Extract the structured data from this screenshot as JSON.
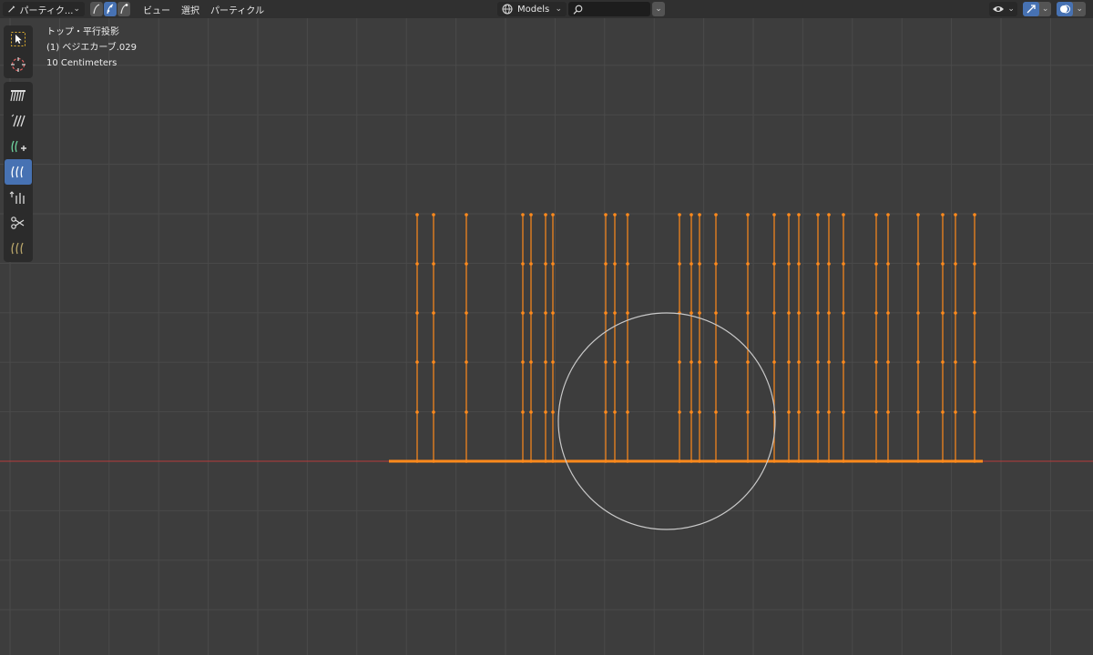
{
  "header": {
    "mode_label": "パーティク...",
    "menus": [
      {
        "label": "ビュー"
      },
      {
        "label": "選択"
      },
      {
        "label": "パーティクル"
      }
    ],
    "collection_label": "Models",
    "search_placeholder": ""
  },
  "overlay": {
    "view_name": "トップ・平行投影",
    "object_name": "(1) ベジエカーブ.029",
    "scale": "10 Centimeters"
  },
  "toolbar": {
    "tools": [
      {
        "icon": "select-box-icon",
        "active": false
      },
      {
        "icon": "cursor-icon",
        "active": false
      },
      {
        "icon": "comb-icon",
        "active": false
      },
      {
        "icon": "smooth-icon",
        "active": false
      },
      {
        "icon": "add-hair-icon",
        "active": false
      },
      {
        "icon": "length-icon",
        "active": true
      },
      {
        "icon": "puff-icon",
        "active": false
      },
      {
        "icon": "cut-icon",
        "active": false
      },
      {
        "icon": "weight-icon",
        "active": false
      }
    ]
  },
  "colors": {
    "background": "#3d3d3d",
    "grid": "#4a4a4a",
    "x_axis": "#b83a3a",
    "hair": "#ff8a1c",
    "brush_circle": "#c9c9c9",
    "active_tool": "#4772b3"
  }
}
